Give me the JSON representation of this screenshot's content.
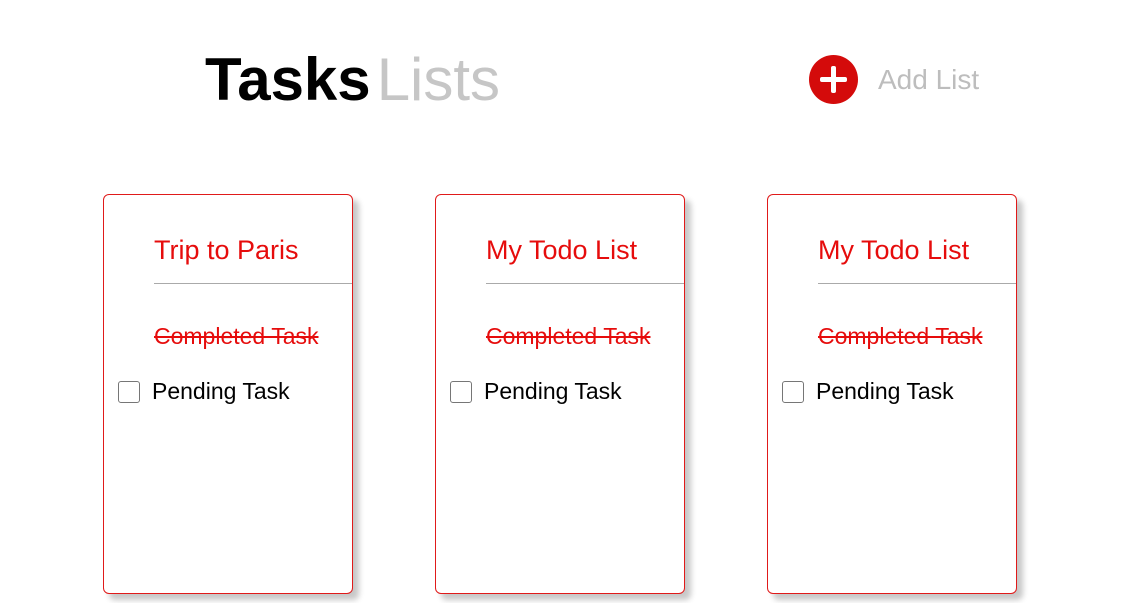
{
  "header": {
    "tab_tasks": "Tasks",
    "tab_lists": "Lists",
    "add_list_label": "Add List",
    "add_icon": "plus-circle-icon"
  },
  "colors": {
    "accent": "#d40b0b",
    "inactive": "#c6c6c6"
  },
  "lists": [
    {
      "title": "Trip to Paris",
      "completed_task": "Completed Task",
      "pending_task": "Pending Task"
    },
    {
      "title": "My Todo List",
      "completed_task": "Completed Task",
      "pending_task": "Pending Task"
    },
    {
      "title": "My Todo List",
      "completed_task": "Completed Task",
      "pending_task": "Pending Task"
    }
  ]
}
